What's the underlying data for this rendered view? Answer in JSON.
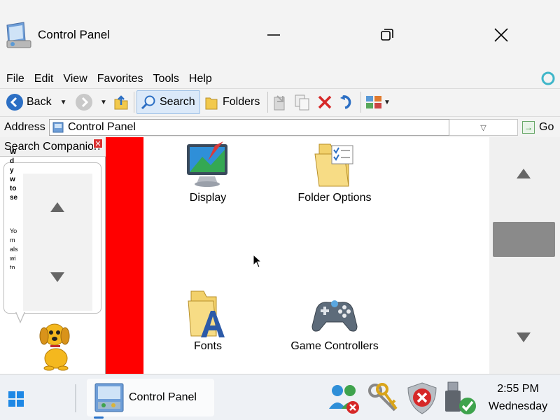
{
  "window": {
    "title": "Control Panel",
    "controls": {
      "minimize": "minimize-icon",
      "maximize": "restore-icon",
      "close": "close-icon"
    }
  },
  "menu": [
    "File",
    "Edit",
    "View",
    "Favorites",
    "Tools",
    "Help"
  ],
  "toolbar": {
    "back_label": "Back",
    "search_label": "Search",
    "folders_label": "Folders"
  },
  "address": {
    "label": "Address",
    "value": "Control Panel",
    "go_label": "Go"
  },
  "companion": {
    "title": "Search Companion",
    "bubble_bold_text": "W\nd\ny\nw\nto\nse",
    "bubble_text": "Yo\nm\nals\nwi\nto"
  },
  "items": [
    {
      "label": "Display",
      "icon": "display-icon"
    },
    {
      "label": "Folder Options",
      "icon": "folder-options-icon"
    },
    {
      "label": "Fonts",
      "icon": "fonts-icon"
    },
    {
      "label": "Game Controllers",
      "icon": "game-controller-icon"
    }
  ],
  "taskbar": {
    "task_label": "Control Panel",
    "time": "2:55 PM",
    "day": "Wednesday"
  },
  "colors": {
    "accent_red": "#ff0000",
    "selection": "#dbe9f9",
    "scroll_thumb": "#8a8a8a"
  }
}
